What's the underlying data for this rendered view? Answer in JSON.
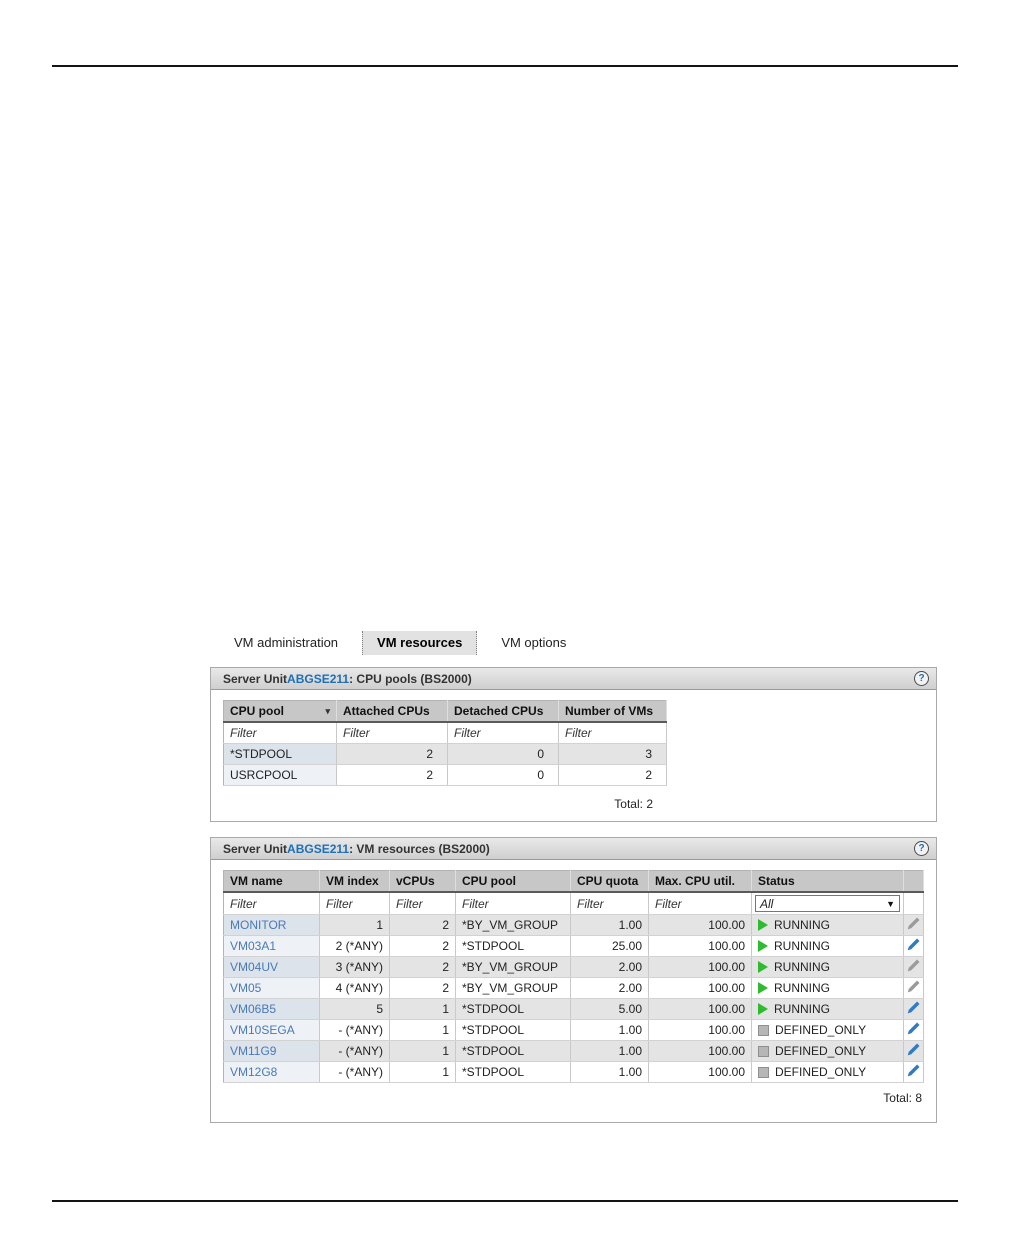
{
  "icons": {
    "sort_desc": "▾",
    "dropdown": "▼",
    "help": "?"
  },
  "colors": {
    "link_blue": "#1d70b7",
    "vm_link_blue": "#4a7ab5",
    "running_green": "#2fbb2f",
    "defined_gray": "#b6b6b6",
    "pencil_blue": "#2f7cc4",
    "pencil_gray": "#9b9b9b"
  },
  "tabs": {
    "items": [
      {
        "label": "VM administration"
      },
      {
        "label": "VM resources"
      },
      {
        "label": "VM options"
      }
    ]
  },
  "cpu_pools_panel": {
    "title_prefix": "Server Unit ",
    "server_link": "ABGSE211",
    "title_rest": ": CPU pools (BS2000)",
    "columns": {
      "pool": "CPU pool",
      "attached": "Attached CPUs",
      "detached": "Detached CPUs",
      "vms": "Number of VMs"
    },
    "filter_label": "Filter",
    "rows": [
      {
        "pool": "*STDPOOL",
        "attached": "2",
        "detached": "0",
        "vms": "3"
      },
      {
        "pool": "USRCPOOL",
        "attached": "2",
        "detached": "0",
        "vms": "2"
      }
    ],
    "total": "Total: 2"
  },
  "vm_resources_panel": {
    "title_prefix": "Server Unit ",
    "server_link": "ABGSE211",
    "title_rest": ": VM resources (BS2000)",
    "columns": {
      "name": "VM name",
      "index": "VM index",
      "vcpus": "vCPUs",
      "pool": "CPU pool",
      "quota": "CPU quota",
      "util": "Max. CPU util.",
      "status": "Status"
    },
    "filter_label": "Filter",
    "status_filter_value": "All",
    "rows": [
      {
        "name": "MONITOR",
        "index": "1",
        "vcpus": "2",
        "pool": "*BY_VM_GROUP",
        "quota": "1.00",
        "util": "100.00",
        "status": "RUNNING"
      },
      {
        "name": "VM03A1",
        "index": "2 (*ANY)",
        "vcpus": "2",
        "pool": "*STDPOOL",
        "quota": "25.00",
        "util": "100.00",
        "status": "RUNNING"
      },
      {
        "name": "VM04UV",
        "index": "3 (*ANY)",
        "vcpus": "2",
        "pool": "*BY_VM_GROUP",
        "quota": "2.00",
        "util": "100.00",
        "status": "RUNNING"
      },
      {
        "name": "VM05",
        "index": "4 (*ANY)",
        "vcpus": "2",
        "pool": "*BY_VM_GROUP",
        "quota": "2.00",
        "util": "100.00",
        "status": "RUNNING"
      },
      {
        "name": "VM06B5",
        "index": "5",
        "vcpus": "1",
        "pool": "*STDPOOL",
        "quota": "5.00",
        "util": "100.00",
        "status": "RUNNING"
      },
      {
        "name": "VM10SEGA",
        "index": "- (*ANY)",
        "vcpus": "1",
        "pool": "*STDPOOL",
        "quota": "1.00",
        "util": "100.00",
        "status": "DEFINED_ONLY"
      },
      {
        "name": "VM11G9",
        "index": "- (*ANY)",
        "vcpus": "1",
        "pool": "*STDPOOL",
        "quota": "1.00",
        "util": "100.00",
        "status": "DEFINED_ONLY"
      },
      {
        "name": "VM12G8",
        "index": "- (*ANY)",
        "vcpus": "1",
        "pool": "*STDPOOL",
        "quota": "1.00",
        "util": "100.00",
        "status": "DEFINED_ONLY"
      }
    ],
    "total": "Total: 8"
  }
}
